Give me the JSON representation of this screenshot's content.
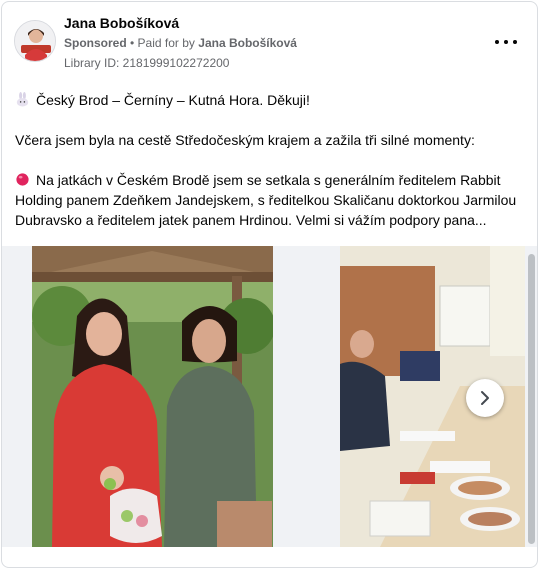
{
  "post": {
    "author": "Jana Bobošíková",
    "sponsored": "Sponsored",
    "paid_for_prefix": "• Paid for by",
    "paid_for_by": "Jana Bobošíková",
    "library_id": "Library ID: 2181999102272200",
    "more_icon": "more-horizontal-icon",
    "avatar": "avatar-photo"
  },
  "content": {
    "line1_icon": "rabbit-emoji",
    "line1": "Český Brod – Černíny – Kutná Hora. Děkuji!",
    "line2": "Včera jsem byla na cestě Středočeským krajem a zažila tři silné momenty:",
    "line3_icon": "red-circle-emoji",
    "line3": "Na jatkách v Českém Brodě jsem se setkala s generálním ředitelem Rabbit Holding panem Zdeňkem Jandejskem, s ředitelkou Skaličanu doktorkou Jarmilou Dubravsko a ředitelem jatek panem Hrdinou. Velmi si vážím podpory pana..."
  },
  "carousel": {
    "slides": [
      "photo-two-women-gazebo",
      "photo-meeting-room-table"
    ],
    "next_icon": "chevron-right-icon"
  }
}
